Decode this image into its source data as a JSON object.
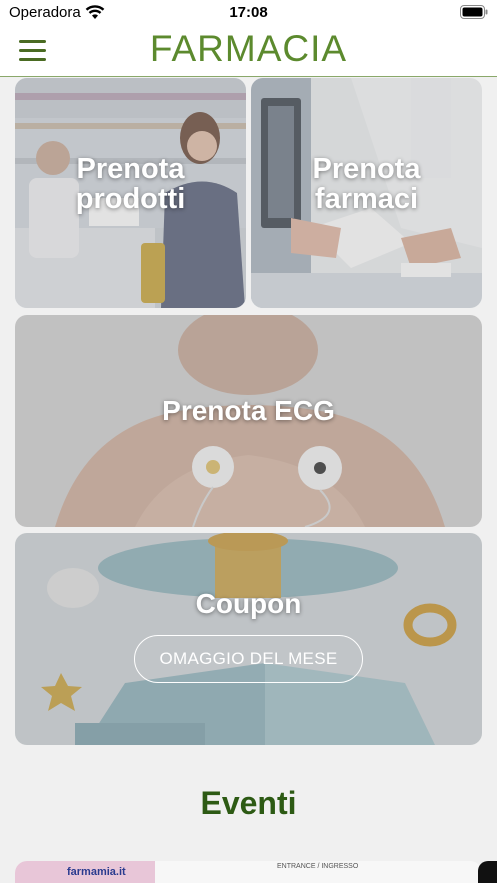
{
  "status_bar": {
    "carrier": "Operadora",
    "time": "17:08",
    "wifi_icon": "wifi-icon",
    "battery_icon": "battery-icon"
  },
  "header": {
    "menu_icon": "hamburger-menu-icon",
    "title": "FARMACIA",
    "title_color": "#5c8a2e",
    "menu_color": "#4a6b22"
  },
  "tiles": [
    {
      "label_line1": "Prenota",
      "label_line2": "prodotti"
    },
    {
      "label_line1": "Prenota",
      "label_line2": "farmaci"
    },
    {
      "label": "Prenota ECG"
    },
    {
      "label": "Coupon",
      "button": "OMAGGIO DEL MESE"
    }
  ],
  "events": {
    "title": "Eventi",
    "title_color": "#2d5a14",
    "banner_logo": "farmamia.it",
    "banner_sign": "ENTRANCE / INGRESSO"
  }
}
